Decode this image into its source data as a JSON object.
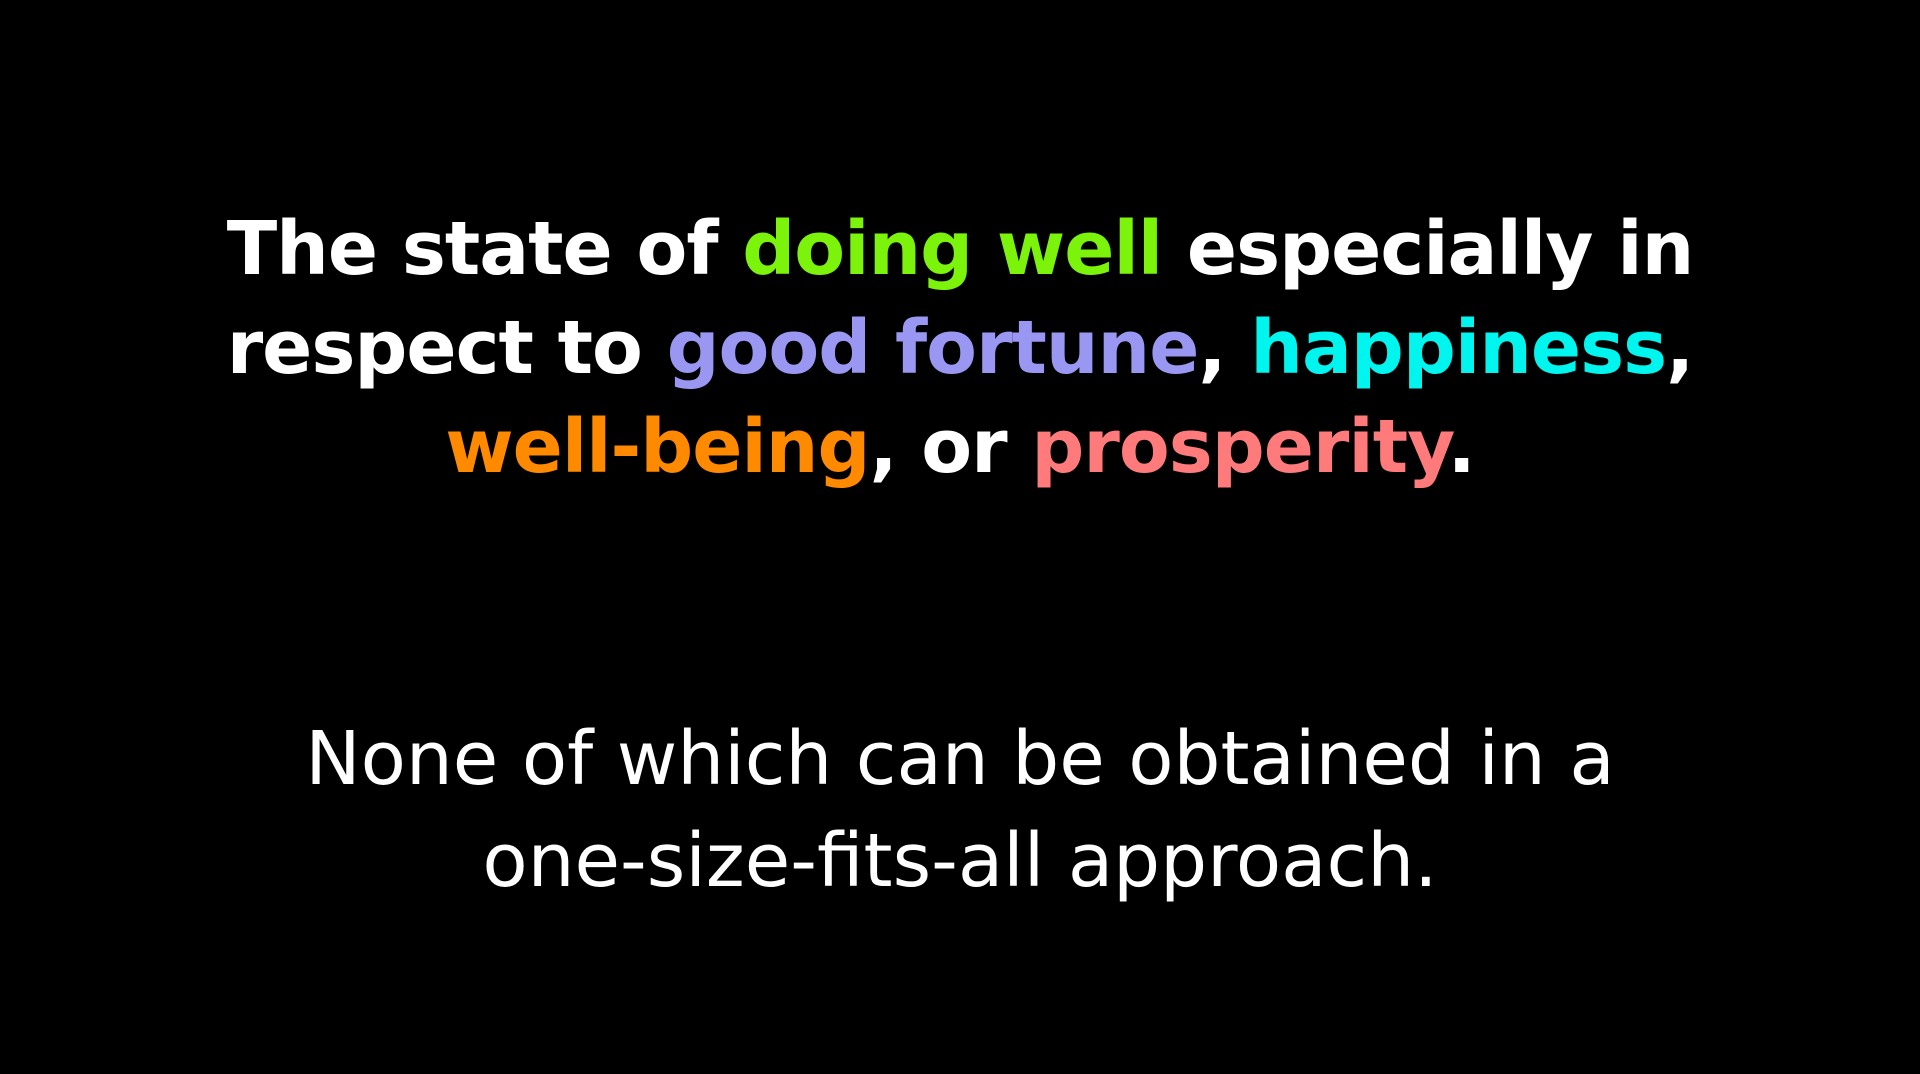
{
  "definition": {
    "line1": {
      "part1": "The state of ",
      "highlight1": "doing well",
      "part2": " especially in"
    },
    "line2": {
      "part1": "respect to ",
      "highlight1": "good fortune",
      "part2": ", ",
      "highlight2": "happiness",
      "part3": ","
    },
    "line3": {
      "highlight1": "well-being",
      "part1": ", or ",
      "highlight2": "prosperity",
      "part2": "."
    }
  },
  "conclusion": {
    "line1": "None of which can be obtained in a",
    "line2": "one-size-fits-all approach."
  },
  "colors": {
    "background": "#000000",
    "text": "#ffffff",
    "doing_well": "#7cf30a",
    "good_fortune": "#9a97f2",
    "happiness": "#00f5ef",
    "well_being": "#ff8a00",
    "prosperity": "#ff7a7a"
  }
}
